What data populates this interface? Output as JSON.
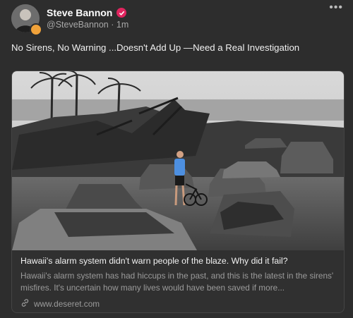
{
  "author": {
    "name": "Steve Bannon",
    "handle": "@SteveBannon",
    "separator": "·",
    "time": "1m"
  },
  "post": {
    "text": "No Sirens, No Warning ...Doesn't Add Up —Need a Real Investigation"
  },
  "link_preview": {
    "title": "Hawaii's alarm system didn't warn people of the blaze. Why did it fail?",
    "description": "Hawaii's alarm system has had hiccups in the past, and this is the latest in the sirens' misfires. It's uncertain how many lives would have been saved if more...",
    "domain": "www.deseret.com"
  },
  "icons": {
    "verified": "verified-badge-icon",
    "more": "more-options-icon",
    "link": "link-icon"
  },
  "colors": {
    "background": "#2d2d2d",
    "verified_badge": "#e0245e",
    "avatar_badge": "#f0a23a"
  }
}
